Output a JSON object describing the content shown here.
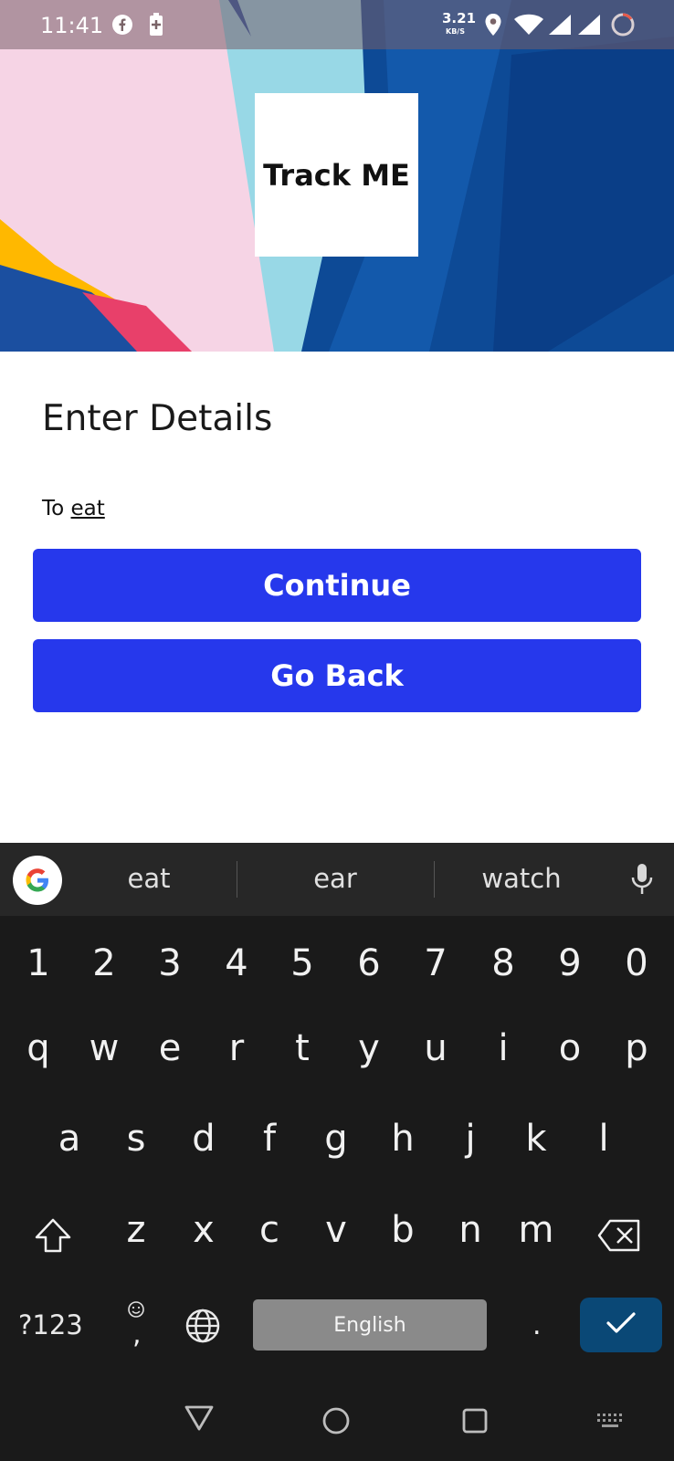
{
  "status_bar": {
    "time": "11:41",
    "net_speed_value": "3.21",
    "net_speed_unit": "KB/S"
  },
  "app": {
    "logo_text": "Track ME"
  },
  "form": {
    "title": "Enter Details",
    "field_prefix": "To",
    "field_value": "eat",
    "continue_label": "Continue",
    "back_label": "Go Back"
  },
  "keyboard": {
    "suggestions": [
      "eat",
      "ear",
      "watch"
    ],
    "row_numbers": [
      "1",
      "2",
      "3",
      "4",
      "5",
      "6",
      "7",
      "8",
      "9",
      "0"
    ],
    "row_1": [
      "q",
      "w",
      "e",
      "r",
      "t",
      "y",
      "u",
      "i",
      "o",
      "p"
    ],
    "row_2": [
      "a",
      "s",
      "d",
      "f",
      "g",
      "h",
      "j",
      "k",
      "l"
    ],
    "row_3": [
      "z",
      "x",
      "c",
      "v",
      "b",
      "n",
      "m"
    ],
    "symbols_key": "?123",
    "comma_key": ",",
    "period_key": ".",
    "space_label": "English",
    "accent_color": "#0a4876"
  },
  "colors": {
    "button": "#2638ec"
  },
  "icons": [
    "facebook-icon",
    "battery-saver-icon",
    "location-icon",
    "wifi-icon",
    "signal-icon",
    "loading-icon",
    "google-icon",
    "mic-icon",
    "shift-icon",
    "backspace-icon",
    "emoji-icon",
    "globe-icon",
    "check-icon",
    "back-nav-icon",
    "home-nav-icon",
    "recents-nav-icon",
    "keyboard-toggle-icon"
  ]
}
